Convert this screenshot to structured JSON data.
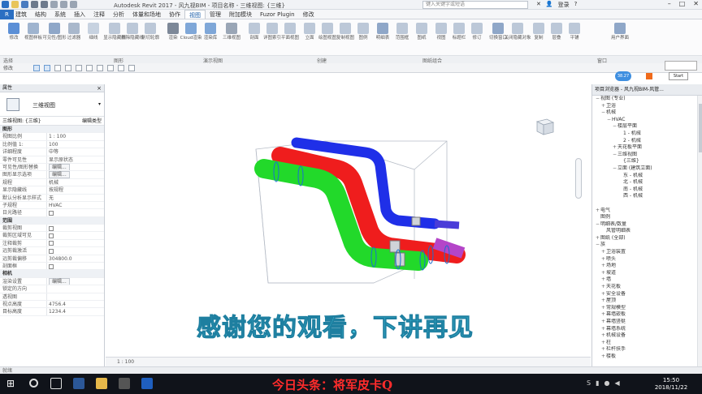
{
  "window": {
    "title": "Autodesk Revit 2017 - 风九视BIM - 项目名称 - 三维视图: {三维}",
    "search_placeholder": "键入关键字或短语",
    "login_label": "登录",
    "help_label": "?"
  },
  "tabs": {
    "file": "R",
    "items": [
      "建筑",
      "结构",
      "系统",
      "插入",
      "注释",
      "分析",
      "体量和场地",
      "协作",
      "视图",
      "管理",
      "附加模块",
      "Fuzor Plugin",
      "修改"
    ],
    "active_index": 8
  },
  "ribbon": {
    "buttons": [
      {
        "label": "修改",
        "icon": "modify-arrow-icon",
        "color": "#5b8fd6"
      },
      {
        "label": "视图样板",
        "icon": "view-template-icon",
        "color": "#9fb4cf"
      },
      {
        "label": "可见性/图形",
        "icon": "visibility-icon",
        "color": "#8fa7c8"
      },
      {
        "label": "过滤器",
        "icon": "filter-icon",
        "color": "#a9b8cc"
      },
      {
        "label": "细线",
        "icon": "thin-lines-icon",
        "color": "#c7d2e0"
      },
      {
        "label": "显示隐藏线",
        "icon": "hidden-lines-icon",
        "color": "#bcc8d8"
      },
      {
        "label": "删除隐藏线",
        "icon": "remove-hidden-icon",
        "color": "#bcc8d8"
      },
      {
        "label": "剖切轮廓",
        "icon": "cut-profile-icon",
        "color": "#bcc8d8"
      },
      {
        "label": "渲染",
        "icon": "render-teapot-icon",
        "color": "#7d8898"
      },
      {
        "label": "Cloud渲染",
        "icon": "cloud-render-icon",
        "color": "#7fa7d8"
      },
      {
        "label": "渲染库",
        "icon": "render-gallery-icon",
        "color": "#7fa7d8"
      },
      {
        "label": "三维视图",
        "icon": "3d-view-icon",
        "color": "#9aa6b6"
      },
      {
        "label": "剖面",
        "icon": "section-icon",
        "color": "#bcc8d8"
      },
      {
        "label": "详图索引",
        "icon": "callout-icon",
        "color": "#bcc8d8"
      },
      {
        "label": "平面视图",
        "icon": "plan-view-icon",
        "color": "#bcc8d8"
      },
      {
        "label": "立面",
        "icon": "elevation-icon",
        "color": "#bcc8d8"
      },
      {
        "label": "绘图视图",
        "icon": "drafting-view-icon",
        "color": "#bcc8d8"
      },
      {
        "label": "复制视图",
        "icon": "duplicate-view-icon",
        "color": "#bcc8d8"
      },
      {
        "label": "图例",
        "icon": "legend-icon",
        "color": "#bcc8d8"
      },
      {
        "label": "明细表",
        "icon": "schedule-icon",
        "color": "#8fa7c8"
      },
      {
        "label": "范围框",
        "icon": "scope-box-icon",
        "color": "#bcc8d8"
      },
      {
        "label": "图纸",
        "icon": "sheet-icon",
        "color": "#bcc8d8"
      },
      {
        "label": "视图",
        "icon": "place-view-icon",
        "color": "#bcc8d8"
      },
      {
        "label": "标题栏",
        "icon": "title-block-icon",
        "color": "#bcc8d8"
      },
      {
        "label": "修订",
        "icon": "revisions-icon",
        "color": "#bcc8d8"
      },
      {
        "label": "切换窗口",
        "icon": "switch-window-icon",
        "color": "#8fa7c8"
      },
      {
        "label": "关闭隐藏对象",
        "icon": "close-hidden-icon",
        "color": "#bcc8d8"
      },
      {
        "label": "复制",
        "icon": "replicate-icon",
        "color": "#bcc8d8"
      },
      {
        "label": "层叠",
        "icon": "cascade-icon",
        "color": "#bcc8d8"
      },
      {
        "label": "平铺",
        "icon": "tile-icon",
        "color": "#bcc8d8"
      },
      {
        "label": "用户界面",
        "icon": "user-interface-icon",
        "color": "#8fa7c8"
      }
    ],
    "panels": [
      "选择",
      "图形",
      "演示视图",
      "创建",
      "图纸组合",
      "窗口"
    ]
  },
  "options_bar": {
    "label": "修改"
  },
  "floating": {
    "badge": "38.27",
    "start_label": "Start"
  },
  "properties": {
    "header": "属性",
    "type_name": "三维视图",
    "filter_label": "三维视图: {三维}",
    "edit_type": "编辑类型",
    "rows": [
      {
        "k": "图形",
        "v": "",
        "section": true
      },
      {
        "k": "视图比例",
        "v": "1 : 100"
      },
      {
        "k": "比例值 1:",
        "v": "100"
      },
      {
        "k": "详细程度",
        "v": "中等"
      },
      {
        "k": "零件可见性",
        "v": "显示原状态"
      },
      {
        "k": "可见性/图形替换",
        "v": "编辑...",
        "button": true
      },
      {
        "k": "图形显示选项",
        "v": "编辑...",
        "button": true
      },
      {
        "k": "规程",
        "v": "机械"
      },
      {
        "k": "显示隐藏线",
        "v": "按规程"
      },
      {
        "k": "默认分析显示样式",
        "v": "无"
      },
      {
        "k": "子规程",
        "v": "HVAC"
      },
      {
        "k": "日光路径",
        "v": "",
        "check": true
      },
      {
        "k": "范围",
        "v": "",
        "section": true
      },
      {
        "k": "裁剪视图",
        "v": "",
        "check": true
      },
      {
        "k": "裁剪区域可见",
        "v": "",
        "check": true
      },
      {
        "k": "注释裁剪",
        "v": "",
        "check": true
      },
      {
        "k": "远剪裁激活",
        "v": "",
        "check": true
      },
      {
        "k": "远剪裁偏移",
        "v": "304800.0"
      },
      {
        "k": "剖面框",
        "v": "",
        "check": true
      },
      {
        "k": "相机",
        "v": "",
        "section": true
      },
      {
        "k": "渲染设置",
        "v": "编辑...",
        "button": true
      },
      {
        "k": "锁定的方向",
        "v": ""
      },
      {
        "k": "透视图",
        "v": ""
      },
      {
        "k": "视点高度",
        "v": "4756.4"
      },
      {
        "k": "目标高度",
        "v": "1234.4"
      }
    ]
  },
  "browser": {
    "header": "项目浏览器 - 风九视BIM-风管...",
    "items": [
      {
        "t": "视图 (专业)",
        "d": 0,
        "g": "−"
      },
      {
        "t": "卫浴",
        "d": 1,
        "g": "+"
      },
      {
        "t": "机械",
        "d": 1,
        "g": "−"
      },
      {
        "t": "HVAC",
        "d": 2,
        "g": "−"
      },
      {
        "t": "楼层平面",
        "d": 3,
        "g": "−"
      },
      {
        "t": "1 - 机械",
        "d": 4,
        "g": ""
      },
      {
        "t": "2 - 机械",
        "d": 4,
        "g": ""
      },
      {
        "t": "天花板平面",
        "d": 3,
        "g": "+"
      },
      {
        "t": "三维视图",
        "d": 3,
        "g": "−"
      },
      {
        "t": "{三维}",
        "d": 4,
        "g": ""
      },
      {
        "t": "立面 (建筑立面)",
        "d": 3,
        "g": "−"
      },
      {
        "t": "东 - 机械",
        "d": 4,
        "g": ""
      },
      {
        "t": "北 - 机械",
        "d": 4,
        "g": ""
      },
      {
        "t": "南 - 机械",
        "d": 4,
        "g": ""
      },
      {
        "t": "西 - 机械",
        "d": 4,
        "g": ""
      },
      {
        "t": "",
        "d": 0,
        "g": ""
      },
      {
        "t": "电气",
        "d": 0,
        "g": "+"
      },
      {
        "t": "图例",
        "d": 0,
        "g": ""
      },
      {
        "t": "明细表/数量",
        "d": 0,
        "g": "−"
      },
      {
        "t": "风管明细表",
        "d": 1,
        "g": ""
      },
      {
        "t": "图纸 (全部)",
        "d": 0,
        "g": "+"
      },
      {
        "t": "族",
        "d": 0,
        "g": "−"
      },
      {
        "t": "卫浴装置",
        "d": 1,
        "g": "+"
      },
      {
        "t": "喷头",
        "d": 1,
        "g": "+"
      },
      {
        "t": "场地",
        "d": 1,
        "g": "+"
      },
      {
        "t": "坡道",
        "d": 1,
        "g": "+"
      },
      {
        "t": "墙",
        "d": 1,
        "g": "+"
      },
      {
        "t": "天花板",
        "d": 1,
        "g": "+"
      },
      {
        "t": "安全设备",
        "d": 1,
        "g": "+"
      },
      {
        "t": "屋顶",
        "d": 1,
        "g": "+"
      },
      {
        "t": "常规模型",
        "d": 1,
        "g": "+"
      },
      {
        "t": "幕墙嵌板",
        "d": 1,
        "g": "+"
      },
      {
        "t": "幕墙竖梃",
        "d": 1,
        "g": "+"
      },
      {
        "t": "幕墙系统",
        "d": 1,
        "g": "+"
      },
      {
        "t": "机械设备",
        "d": 1,
        "g": "+"
      },
      {
        "t": "柱",
        "d": 1,
        "g": "+"
      },
      {
        "t": "栏杆扶手",
        "d": 1,
        "g": "+"
      },
      {
        "t": "楼板",
        "d": 1,
        "g": "+"
      }
    ]
  },
  "view_bar": {
    "scale": "1 : 100"
  },
  "status_bar": {
    "text": "就绪"
  },
  "taskbar": {
    "time": "15:50",
    "date": "2018/11/22"
  },
  "overlay": {
    "subtitle": "感谢您的观看，下讲再见",
    "watermark": "今日头条：将军皮卡Q"
  },
  "colors": {
    "duct_blue": "#1f2fe8",
    "duct_red": "#ef1d1d",
    "duct_green": "#22d92a",
    "subtitle": "#47d0e8",
    "watermark": "#ff2c2c"
  }
}
